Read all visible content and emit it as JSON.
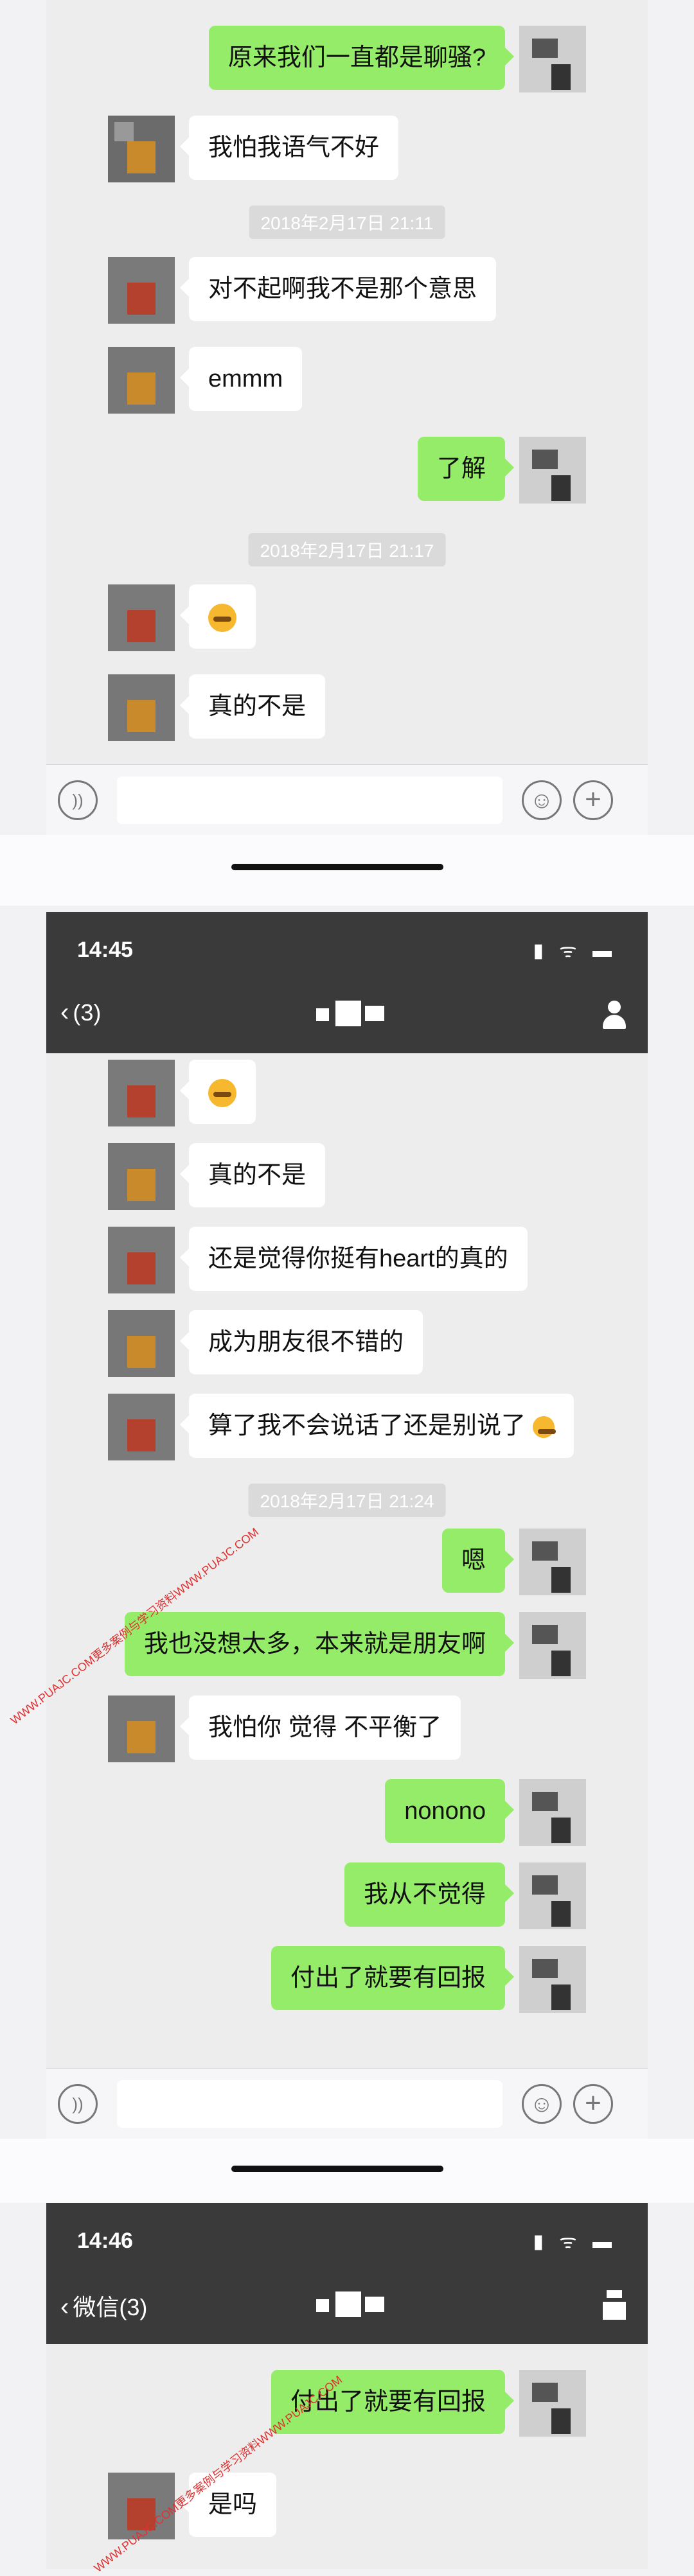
{
  "screens": [
    {
      "messages": [
        {
          "side": "right",
          "text": "原来我们一直都是聊骚?"
        },
        {
          "side": "left",
          "text": "我怕我语气不好"
        },
        {
          "stamp": "2018年2月17日 21:11"
        },
        {
          "side": "left",
          "text": "对不起啊我不是那个意思"
        },
        {
          "side": "left",
          "text": "emmm"
        },
        {
          "side": "right",
          "text": "了解"
        },
        {
          "stamp": "2018年2月17日 21:17"
        },
        {
          "side": "left",
          "emoji": "sweat-smile"
        },
        {
          "side": "left",
          "text": "真的不是"
        }
      ]
    },
    {
      "status_time": "14:45",
      "nav_back": "(3)",
      "messages": [
        {
          "side": "left",
          "emoji": "sweat-smile"
        },
        {
          "side": "left",
          "text": "真的不是"
        },
        {
          "side": "left",
          "text": "还是觉得你挺有heart的真的"
        },
        {
          "side": "left",
          "text": "成为朋友很不错的"
        },
        {
          "side": "left",
          "text": "算了我不会说话了还是别说了",
          "emoji": "awkward"
        },
        {
          "stamp": "2018年2月17日 21:24"
        },
        {
          "side": "right",
          "text": "嗯"
        },
        {
          "side": "right",
          "text": "我也没想太多，本来就是朋友啊"
        },
        {
          "side": "left",
          "text": "我怕你 觉得 不平衡了"
        },
        {
          "side": "right",
          "text": "nonono"
        },
        {
          "side": "right",
          "text": "我从不觉得"
        },
        {
          "side": "right",
          "text": "付出了就要有回报"
        }
      ]
    },
    {
      "status_time": "14:46",
      "nav_back": "微信(3)",
      "messages": [
        {
          "side": "right",
          "text": "付出了就要有回报"
        },
        {
          "side": "left",
          "text": "是吗"
        }
      ]
    }
  ],
  "watermark": "WWW.PUAJC.COM更多案例与学习资料WWW.PUAJC.COM",
  "colors": {
    "sent_bubble": "#95ec69",
    "received_bubble": "#ffffff",
    "navbar": "#3a3a3a",
    "chat_bg": "#ededed"
  }
}
